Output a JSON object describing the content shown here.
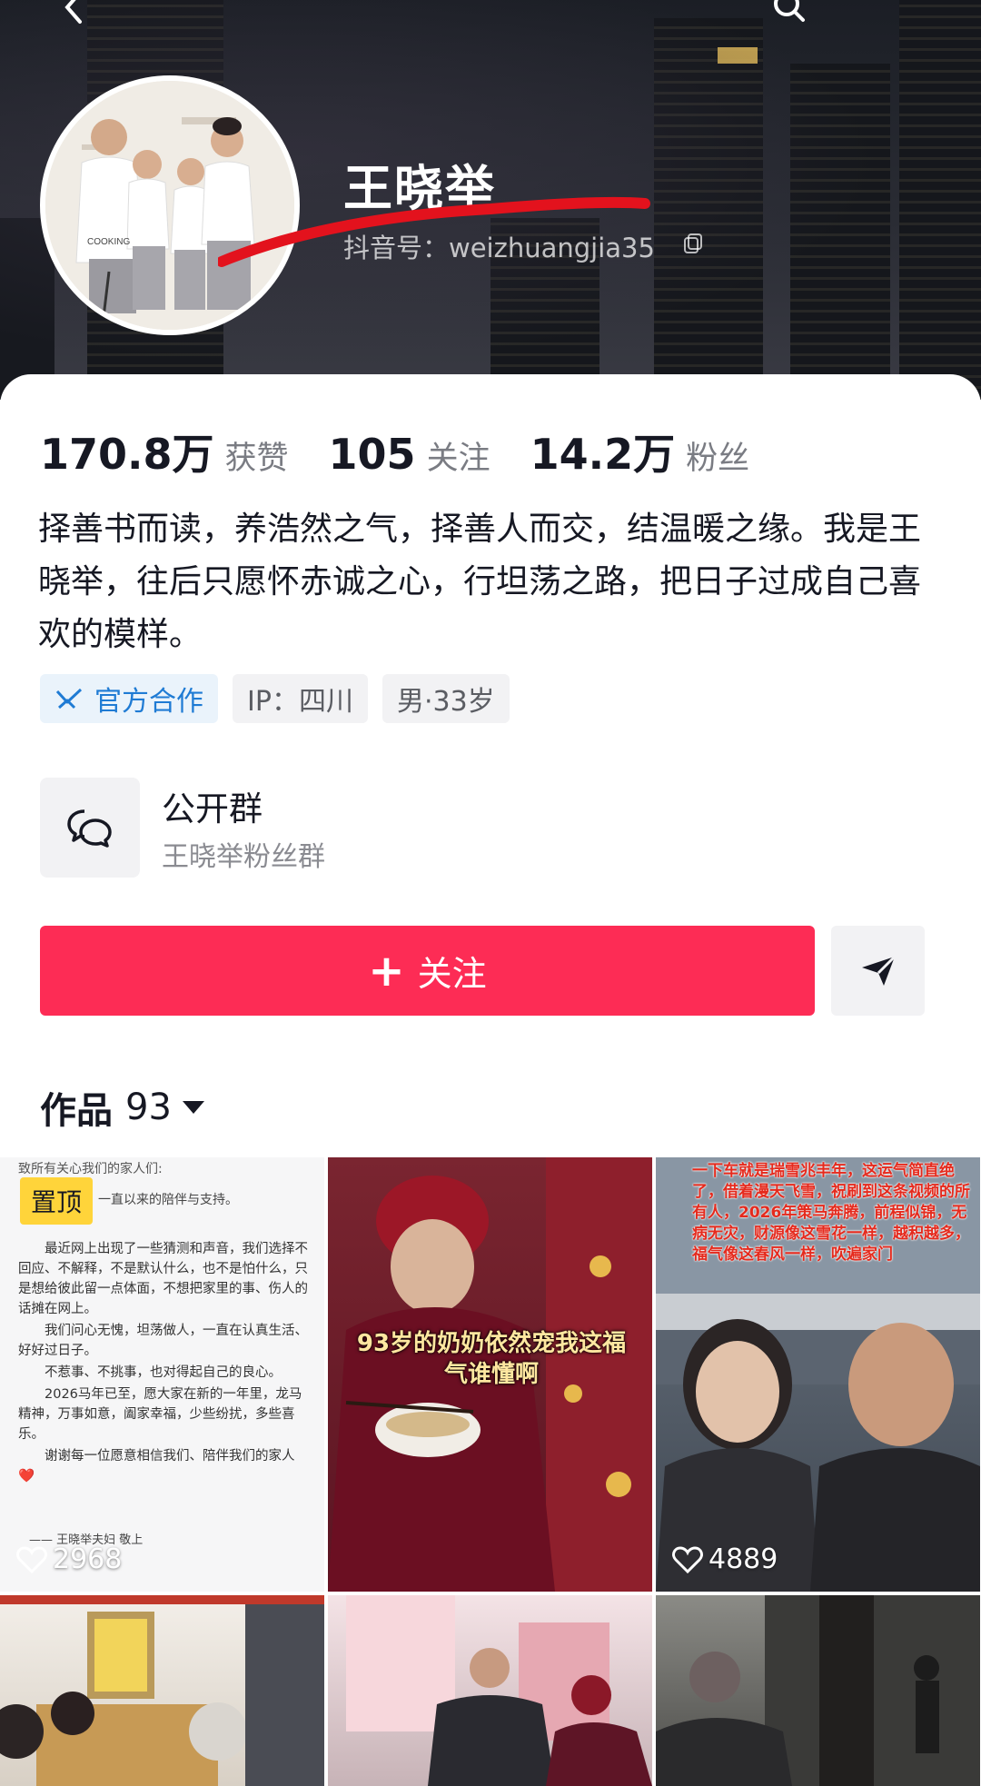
{
  "header": {
    "name": "王晓举",
    "douyin_id": "抖音号：weizhuangjia35"
  },
  "stats": [
    {
      "value": "170.8万",
      "label": "获赞"
    },
    {
      "value": "105",
      "label": "关注"
    },
    {
      "value": "14.2万",
      "label": "粉丝"
    }
  ],
  "bio": "择善书而读，养浩然之气，择善人而交，结温暖之缘。我是王晓举，往后只愿怀赤诚之心，行坦荡之路，把日子过成自己喜欢的模样。",
  "tags": {
    "official": "官方合作",
    "ip": "IP：四川",
    "gender_age": "男·33岁"
  },
  "group": {
    "title": "公开群",
    "subtitle": "王晓举粉丝群"
  },
  "follow_button": "关注",
  "works": {
    "label": "作品",
    "count": "93"
  },
  "videos": [
    {
      "pinned_label": "置顶",
      "likes": "2968",
      "note": {
        "top": "致所有关心我们的家人们:",
        "inline": "一直以来的陪伴与支持。",
        "paragraphs": [
          "最近网上出现了一些猜测和声音，我们选择不回应、不解释，不是默认什么，也不是怕什么，只是想给彼此留一点体面，不想把家里的事、伤人的话摊在网上。",
          "我们问心无愧，坦荡做人，一直在认真生活、好好过日子。",
          "不惹事、不挑事，也对得起自己的良心。",
          "2026马年已至，愿大家在新的一年里，龙马精神，万事如意，阖家幸福，少些纷扰，多些喜乐。",
          "谢谢每一位愿意相信我们、陪伴我们的家人❤️"
        ],
        "signature": "—— 王晓举夫妇 敬上"
      }
    },
    {
      "overlay": "93岁的奶奶依然宠我这福气谁懂啊"
    },
    {
      "likes": "4889",
      "overlay": "一下车就是瑞雪兆丰年，这运气简直绝了，借着漫天飞雪，祝刷到这条视频的所有人，2026年策马奔腾，前程似锦，无病无灾，财源像这雪花一样，越积越多，福气像这春风一样，吹遍家门"
    },
    {},
    {},
    {}
  ],
  "colors": {
    "accent": "#fd2c55",
    "official_blue": "#1f7bd4",
    "pin_yellow": "#ffd43a"
  }
}
